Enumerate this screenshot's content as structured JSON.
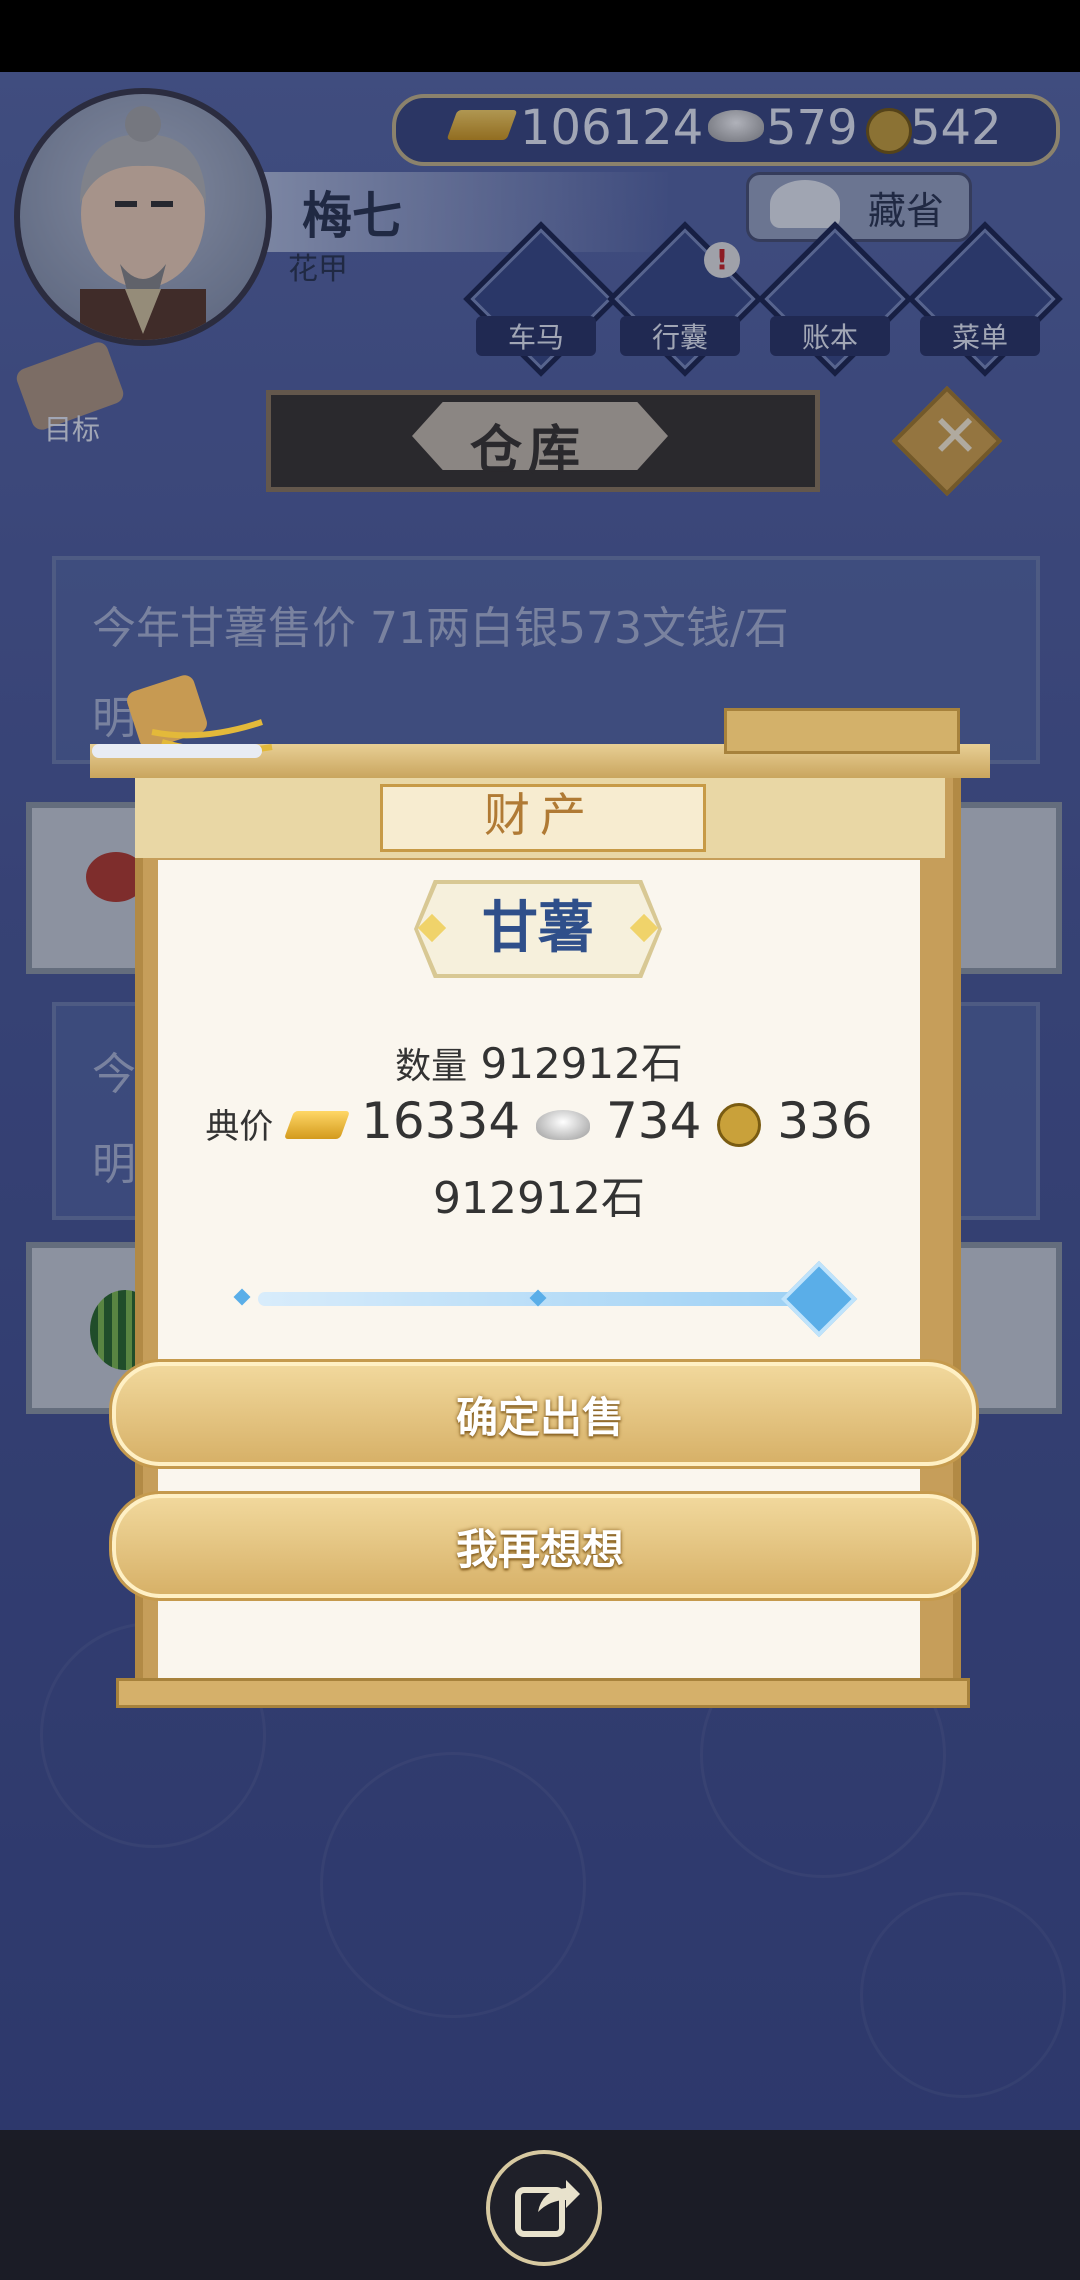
{
  "player": {
    "name": "梅七",
    "title": "花甲"
  },
  "currency": {
    "gold": "106124",
    "silver": "579",
    "coin": "542"
  },
  "collect_button": "藏省",
  "menu": [
    {
      "label": "车马",
      "icon": "carriage-icon"
    },
    {
      "label": "行囊",
      "icon": "bag-icon",
      "badge": "!"
    },
    {
      "label": "账本",
      "icon": "ledger-icon"
    },
    {
      "label": "菜单",
      "icon": "menu-dots-icon"
    }
  ],
  "goal_label": "目标",
  "warehouse_title": "仓库",
  "background": {
    "panel1_line1": "今年甘薯售价 71两白银573文钱/石",
    "panel1_line2": "明",
    "panel2_line1": "今",
    "panel2_line2": "明"
  },
  "dialog": {
    "title": "财产",
    "item_name": "甘薯",
    "quantity_label": "数量",
    "quantity_value": "912912石",
    "price_label": "典价",
    "price_gold": "16334",
    "price_silver": "734",
    "price_coin": "336",
    "selected_quantity": "912912石",
    "slider_level": 1.0,
    "confirm_button": "确定出售",
    "cancel_button": "我再想想"
  },
  "colors": {
    "accent_gold": "#d7b168",
    "slider_blue": "#5aaee8",
    "background_blue": "#4d5b9a"
  }
}
